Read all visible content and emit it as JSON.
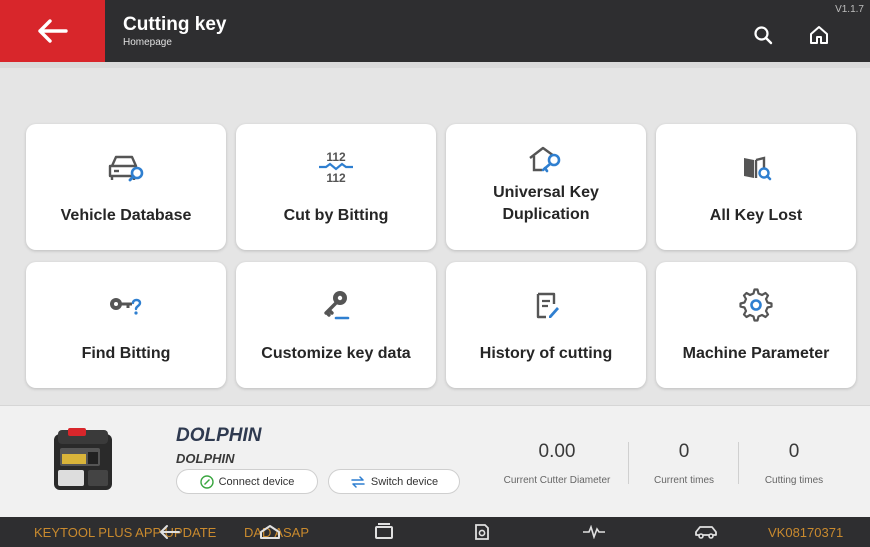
{
  "header": {
    "title": "Cutting key",
    "subtitle": "Homepage",
    "version": "V1.1.7"
  },
  "colors": {
    "accent_red": "#d8262b",
    "header_bg": "#2e2e30",
    "icon_blue": "#2f7fd0",
    "link_green": "#3aa640",
    "nav_orange": "#c98a2e"
  },
  "menu": [
    {
      "label": "Vehicle Database",
      "icon": "car-search-icon"
    },
    {
      "label": "Cut by Bitting",
      "icon": "bitting-code-icon"
    },
    {
      "label": "Universal Key Duplication",
      "icon": "house-key-icon"
    },
    {
      "label": "All Key Lost",
      "icon": "book-search-icon"
    },
    {
      "label": "Find Bitting",
      "icon": "key-question-icon"
    },
    {
      "label": "Customize key data",
      "icon": "key-edit-icon"
    },
    {
      "label": "History of cutting",
      "icon": "document-edit-icon"
    },
    {
      "label": "Machine Parameter",
      "icon": "gear-icon"
    }
  ],
  "bitting_icon_text": {
    "top": "112",
    "bottom": "112"
  },
  "device": {
    "name": "DOLPHIN",
    "model": "DOLPHIN",
    "connect_label": "Connect device",
    "switch_label": "Switch device",
    "stats": [
      {
        "value": "0.00",
        "caption": "Current Cutter Diameter"
      },
      {
        "value": "0",
        "caption": "Current times"
      },
      {
        "value": "0",
        "caption": "Cutting times"
      }
    ]
  },
  "navbar": {
    "left_text": "KEYTOOL PLUS APP UPDATE",
    "left_text_2": "DAD ASAP",
    "right_text": "VK08170371",
    "icons": [
      "back-icon",
      "home-icon",
      "recents-icon",
      "screenshot-icon",
      "pulse-icon",
      "car-icon"
    ]
  }
}
